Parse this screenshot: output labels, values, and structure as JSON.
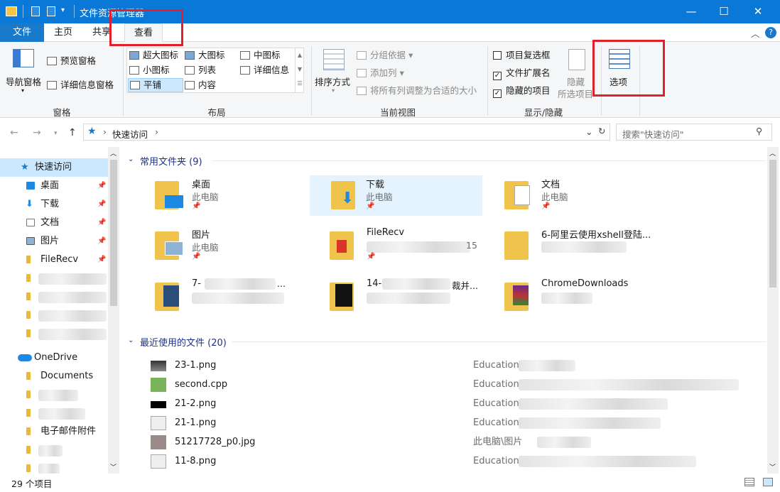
{
  "window": {
    "title": "文件资源管理器",
    "minimize": "—",
    "maximize": "☐",
    "close": "✕"
  },
  "ribbon_tabs": {
    "file": "文件",
    "home": "主页",
    "share": "共享",
    "view": "查看"
  },
  "ribbon": {
    "panes": {
      "nav_pane": "导航窗格",
      "preview": "预览窗格",
      "details": "详细信息窗格",
      "label": "窗格"
    },
    "layout": {
      "xl": "超大图标",
      "large": "大图标",
      "medium": "中图标",
      "small": "小图标",
      "list": "列表",
      "details": "详细信息",
      "tiles": "平铺",
      "content": "内容",
      "label": "布局"
    },
    "current_view": {
      "sort": "排序方式",
      "group": "分组依据",
      "add_col": "添加列",
      "fit_cols": "将所有列调整为合适的大小",
      "label": "当前视图"
    },
    "show_hide": {
      "checkboxes": "项目复选框",
      "extensions": "文件扩展名",
      "hidden": "隐藏的项目",
      "hide1": "隐藏",
      "hide2": "所选项目",
      "label": "显示/隐藏",
      "checkboxes_on": false,
      "extensions_on": true,
      "hidden_on": true
    },
    "options": "选项"
  },
  "address": {
    "path": "快速访问",
    "search_placeholder": "搜索\"快速访问\""
  },
  "nav": {
    "quick_access": "快速访问",
    "items": [
      {
        "label": "桌面"
      },
      {
        "label": "下载"
      },
      {
        "label": "文档"
      },
      {
        "label": "图片"
      },
      {
        "label": "FileRecv"
      }
    ],
    "onedrive": "OneDrive",
    "od_items": [
      {
        "label": "Documents"
      },
      {
        "label": "电子邮件附件"
      }
    ]
  },
  "main": {
    "frequent_header": "常用文件夹 (9)",
    "tiles": [
      {
        "name": "桌面",
        "sub": "此电脑"
      },
      {
        "name": "下载",
        "sub": "此电脑"
      },
      {
        "name": "文档",
        "sub": "此电脑"
      },
      {
        "name": "图片",
        "sub": "此电脑"
      },
      {
        "name": "FileRecv",
        "sub": "15"
      },
      {
        "name": "6-阿里云使用xshell登陆...",
        "sub": ""
      },
      {
        "name": "7-",
        "sub": "..."
      },
      {
        "name": "14-",
        "sub": "裁并..."
      },
      {
        "name": "ChromeDownloads",
        "sub": ""
      }
    ],
    "recent_header": "最近使用的文件 (20)",
    "recent": [
      {
        "name": "23-1.png",
        "loc": "Education"
      },
      {
        "name": "second.cpp",
        "loc": "Education"
      },
      {
        "name": "21-2.png",
        "loc": "Education"
      },
      {
        "name": "21-1.png",
        "loc": "Education"
      },
      {
        "name": "51217728_p0.jpg",
        "loc": "此电脑\\图片"
      },
      {
        "name": "11-8.png",
        "loc": "Education"
      }
    ]
  },
  "status": {
    "count": "29 个项目"
  },
  "colors": {
    "title_bar": "#0a78d7",
    "accent": "#0a78d7",
    "highlight_box": "#e0202a",
    "folder": "#e8b93c",
    "selected_tile": "#e5f3ff"
  }
}
